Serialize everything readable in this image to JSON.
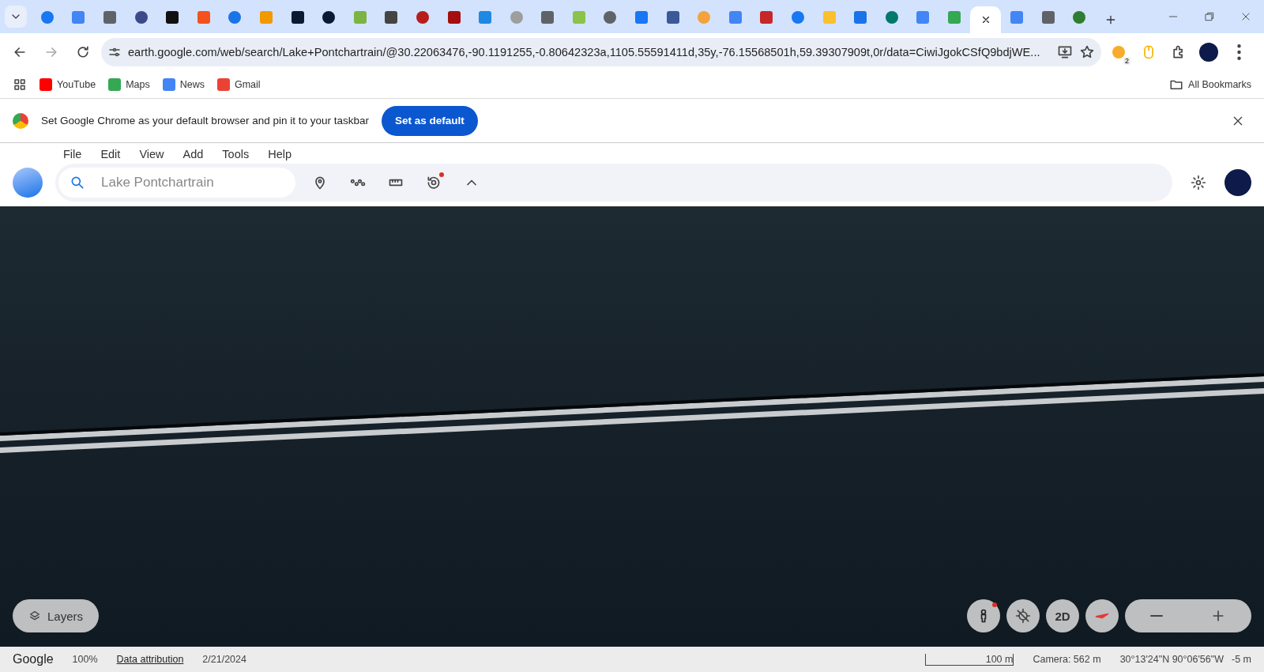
{
  "browser": {
    "tabs": [
      {
        "selected": false
      },
      {
        "selected": false
      },
      {
        "selected": false
      },
      {
        "selected": false
      },
      {
        "selected": false
      },
      {
        "selected": false
      },
      {
        "selected": false
      },
      {
        "selected": false
      },
      {
        "selected": false
      },
      {
        "selected": false
      },
      {
        "selected": false
      },
      {
        "selected": false
      },
      {
        "selected": false
      },
      {
        "selected": false
      },
      {
        "selected": false
      },
      {
        "selected": false
      },
      {
        "selected": false
      },
      {
        "selected": false
      },
      {
        "selected": false
      },
      {
        "selected": false
      },
      {
        "selected": false
      },
      {
        "selected": false
      },
      {
        "selected": false
      },
      {
        "selected": false
      },
      {
        "selected": false
      },
      {
        "selected": false
      },
      {
        "selected": false
      },
      {
        "selected": false
      },
      {
        "selected": false
      },
      {
        "selected": false
      },
      {
        "selected": true
      },
      {
        "selected": false
      },
      {
        "selected": false
      },
      {
        "selected": false
      }
    ],
    "address": "earth.google.com/web/search/Lake+Pontchartrain/@30.22063476,-90.1191255,-0.80642323a,1105.55591411d,35y,-76.15568501h,59.39307909t,0r/data=CiwiJgokCSfQ9bdjWE...",
    "extension_badge": "2",
    "bookmarks": [
      "YouTube",
      "Maps",
      "News",
      "Gmail"
    ],
    "all_bookmarks": "All Bookmarks",
    "infobar": {
      "message": "Set Google Chrome as your default browser and pin it to your taskbar",
      "button": "Set as default"
    }
  },
  "earth": {
    "menu": [
      "File",
      "Edit",
      "View",
      "Add",
      "Tools",
      "Help"
    ],
    "search": {
      "value": "Lake Pontchartrain"
    },
    "layers_button": "Layers",
    "view_button": "2D",
    "status_bar": {
      "logo": "Google",
      "zoom": "100%",
      "attribution": "Data attribution",
      "date": "2/21/2024",
      "scale": "100 m",
      "camera": "Camera: 562 m",
      "coordinates": "30°13'24\"N 90°06'56\"W",
      "elevation": "-5 m"
    }
  }
}
